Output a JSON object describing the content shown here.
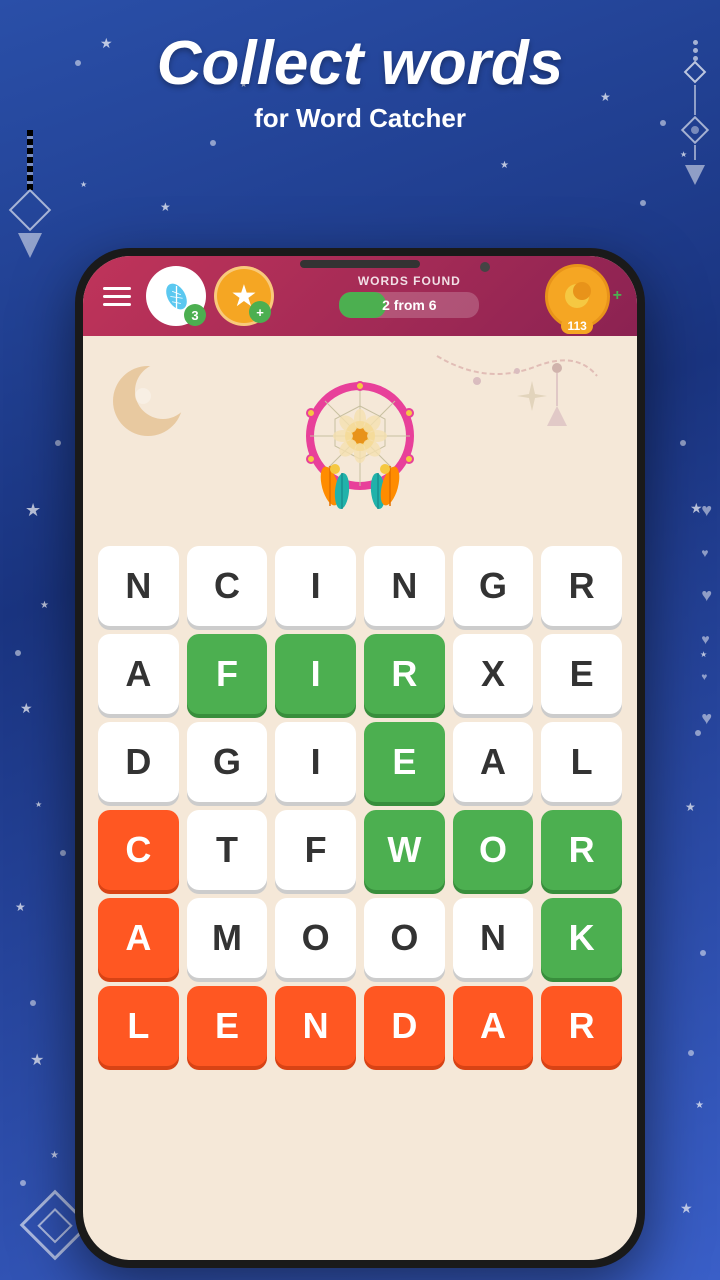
{
  "background": {
    "color": "#2a4fa8"
  },
  "title": {
    "main": "Collect words",
    "sub": "for Word Catcher"
  },
  "header": {
    "menu_label": "Menu",
    "feather_count": "3",
    "star_plus": "+",
    "words_found_label": "WORDS FOUND",
    "words_found_text": "2 from 6",
    "words_found_current": 2,
    "words_found_total": 6,
    "coins_count": "113",
    "coins_plus": "+"
  },
  "grid": {
    "rows": [
      [
        {
          "letter": "N",
          "style": "white"
        },
        {
          "letter": "C",
          "style": "white"
        },
        {
          "letter": "I",
          "style": "white"
        },
        {
          "letter": "N",
          "style": "white"
        },
        {
          "letter": "G",
          "style": "white"
        },
        {
          "letter": "R",
          "style": "white"
        }
      ],
      [
        {
          "letter": "A",
          "style": "white"
        },
        {
          "letter": "F",
          "style": "green"
        },
        {
          "letter": "I",
          "style": "green"
        },
        {
          "letter": "R",
          "style": "green"
        },
        {
          "letter": "X",
          "style": "white"
        },
        {
          "letter": "E",
          "style": "white"
        }
      ],
      [
        {
          "letter": "D",
          "style": "white"
        },
        {
          "letter": "G",
          "style": "white"
        },
        {
          "letter": "I",
          "style": "white"
        },
        {
          "letter": "E",
          "style": "green"
        },
        {
          "letter": "A",
          "style": "white"
        },
        {
          "letter": "L",
          "style": "white"
        }
      ],
      [
        {
          "letter": "C",
          "style": "orange"
        },
        {
          "letter": "T",
          "style": "white"
        },
        {
          "letter": "F",
          "style": "white"
        },
        {
          "letter": "W",
          "style": "green"
        },
        {
          "letter": "O",
          "style": "green"
        },
        {
          "letter": "R",
          "style": "green"
        }
      ],
      [
        {
          "letter": "A",
          "style": "orange"
        },
        {
          "letter": "M",
          "style": "white"
        },
        {
          "letter": "O",
          "style": "white"
        },
        {
          "letter": "O",
          "style": "white"
        },
        {
          "letter": "N",
          "style": "white"
        },
        {
          "letter": "K",
          "style": "green"
        }
      ],
      [
        {
          "letter": "L",
          "style": "orange"
        },
        {
          "letter": "E",
          "style": "orange"
        },
        {
          "letter": "N",
          "style": "orange"
        },
        {
          "letter": "D",
          "style": "orange"
        },
        {
          "letter": "A",
          "style": "orange"
        },
        {
          "letter": "R",
          "style": "orange"
        }
      ]
    ]
  }
}
